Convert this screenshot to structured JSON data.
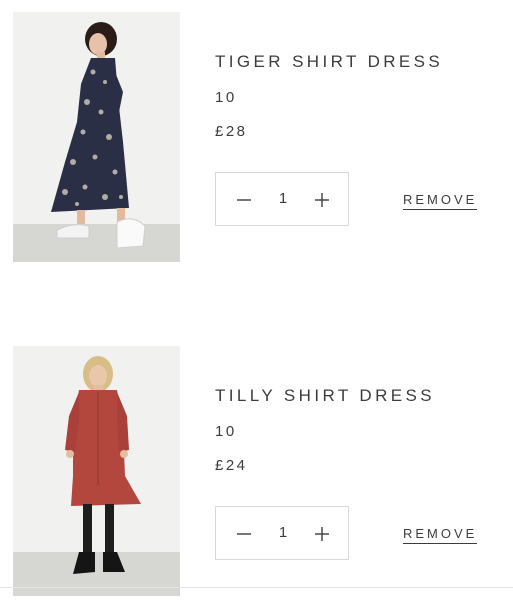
{
  "cart": {
    "items": [
      {
        "title": "TIGER SHIRT DRESS",
        "size": "10",
        "price": "£28",
        "quantity": "1",
        "remove_label": "REMOVE",
        "photo_colors": {
          "dress": "#2b2f45",
          "pattern": "#c9c3b8"
        }
      },
      {
        "title": "TILLY SHIRT DRESS",
        "size": "10",
        "price": "£24",
        "quantity": "1",
        "remove_label": "REMOVE",
        "photo_colors": {
          "dress": "#b4473d",
          "tights": "#1e1e1e"
        }
      }
    ],
    "icons": {
      "decrease": "minus-icon",
      "increase": "plus-icon"
    }
  }
}
